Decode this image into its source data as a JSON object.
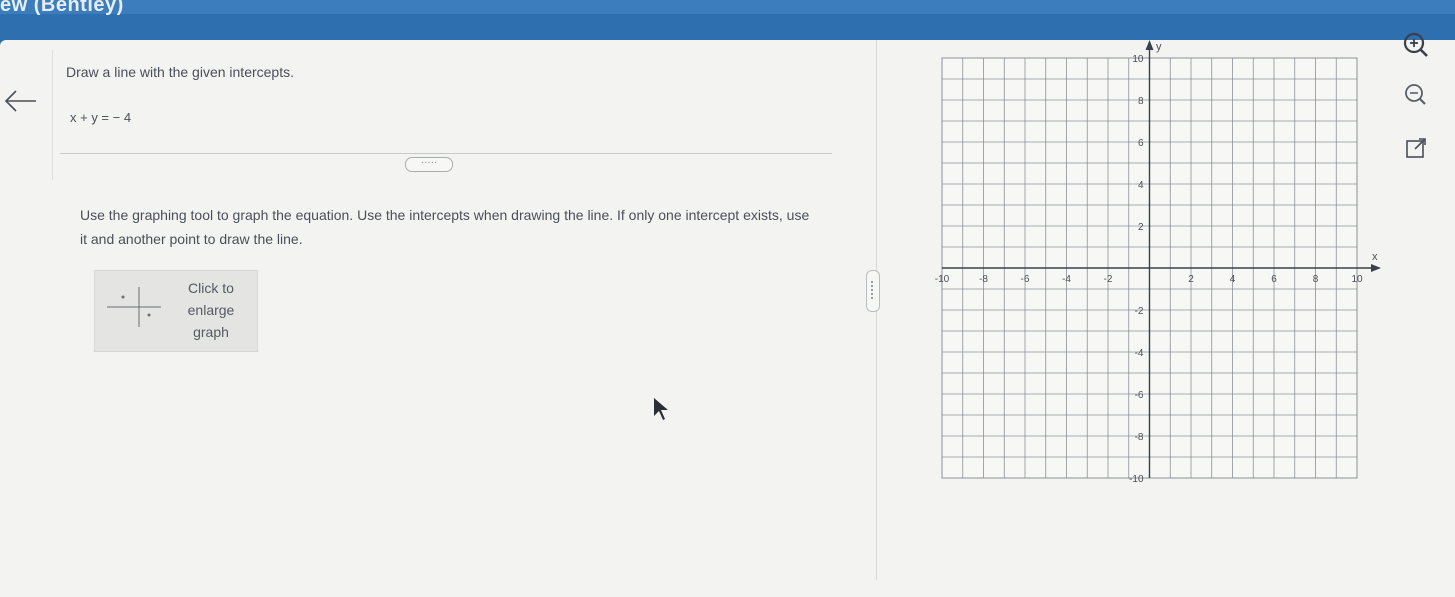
{
  "window": {
    "title": "ew (Bentley)"
  },
  "navigation": {
    "back_icon": "left-arrow-icon"
  },
  "question": {
    "prompt": "Draw a line with the given intercepts.",
    "equation": "x + y = − 4",
    "more_label": "·····",
    "instructions": "Use the graphing tool to graph the equation. Use the intercepts when drawing the line. If only one intercept exists, use it and another point to draw the line.",
    "enlarge": {
      "line1": "Click to",
      "line2": "enlarge",
      "line3": "graph"
    }
  },
  "graph": {
    "x_axis_label": "x",
    "y_axis_label": "y",
    "xlim": [
      -10,
      10
    ],
    "ylim": [
      -10,
      10
    ],
    "grid": true,
    "x_tick_labels": [
      "-10",
      "-8",
      "-6",
      "-4",
      "-2",
      "2",
      "4",
      "6",
      "8",
      "10"
    ],
    "y_tick_labels": [
      "10",
      "8",
      "6",
      "4",
      "2",
      "-2",
      "-4",
      "-6",
      "-8",
      "-10"
    ]
  },
  "toolbar": {
    "zoom_in_icon": "zoom-in-icon",
    "zoom_out_icon": "zoom-out-icon",
    "popout_icon": "popout-icon"
  },
  "colors": {
    "header": "#2e6fb0",
    "grid": "#8c9096",
    "axis": "#3a3f48"
  }
}
